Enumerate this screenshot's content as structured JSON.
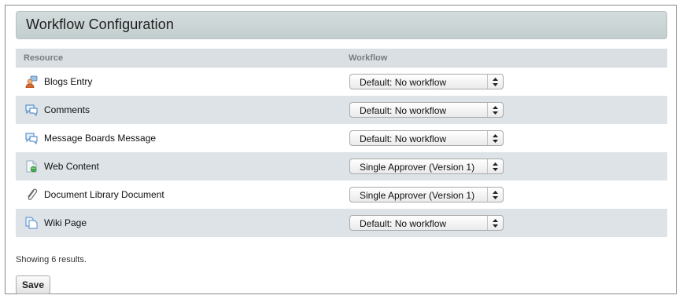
{
  "header": {
    "title": "Workflow Configuration"
  },
  "table": {
    "columns": {
      "resource": "Resource",
      "workflow": "Workflow"
    },
    "rows": [
      {
        "resource": "Blogs Entry",
        "icon": "blogs-entry-icon",
        "workflow": "Default: No workflow"
      },
      {
        "resource": "Comments",
        "icon": "comments-icon",
        "workflow": "Default: No workflow"
      },
      {
        "resource": "Message Boards Message",
        "icon": "message-boards-icon",
        "workflow": "Default: No workflow"
      },
      {
        "resource": "Web Content",
        "icon": "web-content-icon",
        "workflow": "Single Approver (Version 1)"
      },
      {
        "resource": "Document Library Document",
        "icon": "document-clip-icon",
        "workflow": "Single Approver (Version 1)"
      },
      {
        "resource": "Wiki Page",
        "icon": "wiki-page-icon",
        "workflow": "Default: No workflow"
      }
    ]
  },
  "footer": {
    "results_text": "Showing 6 results.",
    "save_label": "Save"
  },
  "colors": {
    "header_bg": "#c9d3d3",
    "row_alt_bg": "#dde3e7",
    "table_header_bg": "#d9dfe3"
  }
}
